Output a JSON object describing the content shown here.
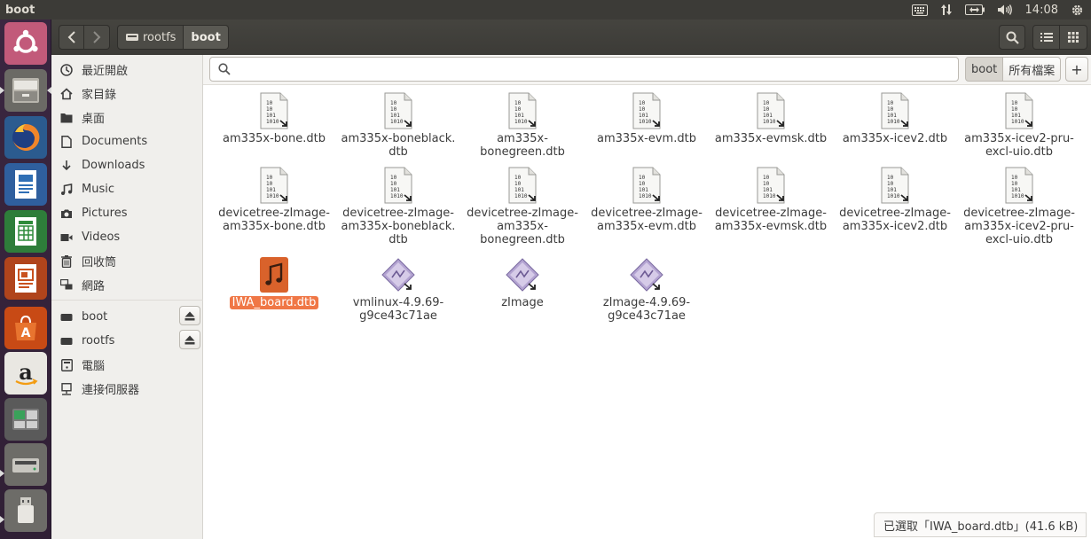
{
  "window": {
    "title": "boot"
  },
  "panel": {
    "time": "14:08"
  },
  "path": [
    "rootfs",
    "boot"
  ],
  "sidebar": {
    "places": [
      {
        "label": "最近開啟",
        "icon": "clock-icon"
      },
      {
        "label": "家目錄",
        "icon": "home-icon"
      },
      {
        "label": "桌面",
        "icon": "folder-icon"
      },
      {
        "label": "Documents",
        "icon": "document-icon"
      },
      {
        "label": "Downloads",
        "icon": "download-icon"
      },
      {
        "label": "Music",
        "icon": "music-icon"
      },
      {
        "label": "Pictures",
        "icon": "camera-icon"
      },
      {
        "label": "Videos",
        "icon": "video-icon"
      },
      {
        "label": "回收筒",
        "icon": "trash-icon"
      },
      {
        "label": "網路",
        "icon": "network-icon"
      }
    ],
    "devices": [
      {
        "label": "boot",
        "icon": "drive-icon"
      },
      {
        "label": "rootfs",
        "icon": "drive-icon"
      },
      {
        "label": "電腦",
        "icon": "computer-icon"
      },
      {
        "label": "連接伺服器",
        "icon": "server-icon"
      }
    ]
  },
  "search": {
    "value": "",
    "placeholder": "",
    "scope_current": "boot",
    "scope_all": "所有檔案",
    "add": "+"
  },
  "files": [
    {
      "name": "am335x-bone.dtb",
      "type": "binary"
    },
    {
      "name": "am335x-boneblack.\ndtb",
      "type": "binary"
    },
    {
      "name": "am335x-\nbonegreen.dtb",
      "type": "binary"
    },
    {
      "name": "am335x-evm.dtb",
      "type": "binary"
    },
    {
      "name": "am335x-evmsk.dtb",
      "type": "binary"
    },
    {
      "name": "am335x-icev2.dtb",
      "type": "binary"
    },
    {
      "name": "am335x-icev2-pru-\nexcl-uio.dtb",
      "type": "binary"
    },
    {
      "name": "devicetree-zImage-\nam335x-bone.dtb",
      "type": "binary"
    },
    {
      "name": "devicetree-zImage-\nam335x-boneblack.\ndtb",
      "type": "binary"
    },
    {
      "name": "devicetree-zImage-\nam335x-\nbonegreen.dtb",
      "type": "binary"
    },
    {
      "name": "devicetree-zImage-\nam335x-evm.dtb",
      "type": "binary"
    },
    {
      "name": "devicetree-zImage-\nam335x-evmsk.dtb",
      "type": "binary"
    },
    {
      "name": "devicetree-zImage-\nam335x-icev2.dtb",
      "type": "binary"
    },
    {
      "name": "devicetree-zImage-\nam335x-icev2-pru-\nexcl-uio.dtb",
      "type": "binary"
    },
    {
      "name": "IWA_board.dtb",
      "type": "audio",
      "selected": true
    },
    {
      "name": "vmlinux-4.9.69-\ng9ce43c71ae",
      "type": "exec"
    },
    {
      "name": "zImage",
      "type": "exec"
    },
    {
      "name": "zImage-4.9.69-\ng9ce43c71ae",
      "type": "exec"
    }
  ],
  "status": {
    "text": "已選取「IWA_board.dtb」(41.6 kB)"
  },
  "colors": {
    "selection": "#f07746",
    "panel": "#3c3b37",
    "launcher": "#3b2741"
  }
}
